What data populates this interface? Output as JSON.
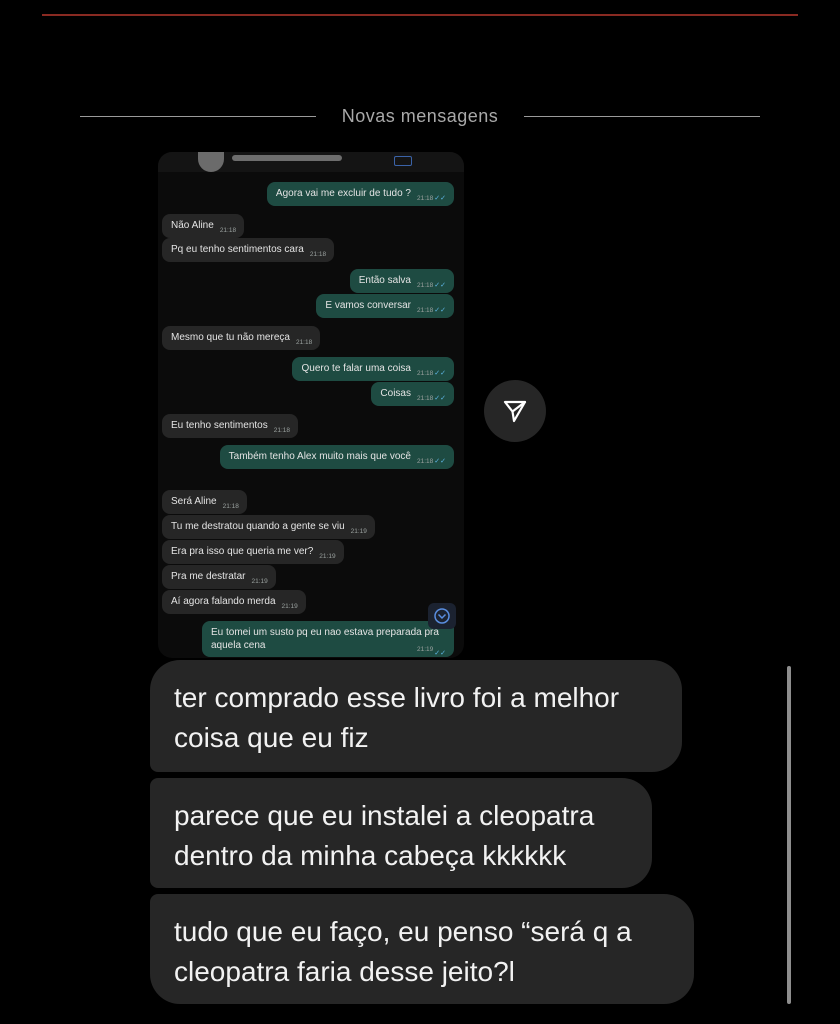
{
  "divider": {
    "label": "Novas mensagens"
  },
  "shared_screenshot": {
    "messages": [
      {
        "id": "m1",
        "dir": "out",
        "text": "Agora vai me excluir de tudo ?",
        "time": "21:18",
        "read": true
      },
      {
        "id": "m2",
        "dir": "in",
        "text": "Não Aline",
        "time": "21:18"
      },
      {
        "id": "m3",
        "dir": "in",
        "text": "Pq eu tenho sentimentos cara",
        "time": "21:18"
      },
      {
        "id": "m4",
        "dir": "out",
        "text": "Então salva",
        "time": "21:18",
        "read": true
      },
      {
        "id": "m5",
        "dir": "out",
        "text": "E vamos conversar",
        "time": "21:18",
        "read": true
      },
      {
        "id": "m6",
        "dir": "in",
        "text": "Mesmo que tu não mereça",
        "time": "21:18"
      },
      {
        "id": "m7",
        "dir": "out",
        "text": "Quero te falar uma coisa",
        "time": "21:18",
        "read": true
      },
      {
        "id": "m8",
        "dir": "out",
        "text": "Coisas",
        "time": "21:18",
        "read": true
      },
      {
        "id": "m9",
        "dir": "in",
        "text": "Eu tenho sentimentos",
        "time": "21:18"
      },
      {
        "id": "m10",
        "dir": "out",
        "text": "Também tenho Alex muito mais que você",
        "time": "21:18",
        "read": true
      },
      {
        "id": "m11",
        "dir": "in",
        "text": "Será Aline",
        "time": "21:18"
      },
      {
        "id": "m12",
        "dir": "in",
        "text": "Tu me destratou quando a gente se viu",
        "time": "21:19"
      },
      {
        "id": "m13",
        "dir": "in",
        "text": "Era pra isso que queria me ver?",
        "time": "21:19"
      },
      {
        "id": "m14",
        "dir": "in",
        "text": "Pra me destratar",
        "time": "21:19"
      },
      {
        "id": "m15",
        "dir": "in",
        "text": "Aí agora falando merda",
        "time": "21:19"
      },
      {
        "id": "m16",
        "dir": "out",
        "text": "Eu tomei um susto pq eu nao estava preparada pra aquela cena",
        "time": "21:19",
        "read": true
      }
    ],
    "read_mark": "✓✓"
  },
  "messages": [
    {
      "text": "ter comprado esse livro foi a melhor coisa que eu fiz"
    },
    {
      "text": "parece que eu instalei a cleopatra dentro da minha cabeça kkkkkk"
    },
    {
      "text": "tudo que eu faço, eu penso “será q a cleopatra faria desse jeito?l"
    }
  ],
  "icons": {
    "share": "paper-plane-icon",
    "scroll_down": "chevron-down-icon"
  },
  "colors": {
    "background": "#000000",
    "bubble_incoming": "#262626",
    "bubble_outgoing_shot": "#1e4b42",
    "accent_line": "#8a2a22"
  }
}
